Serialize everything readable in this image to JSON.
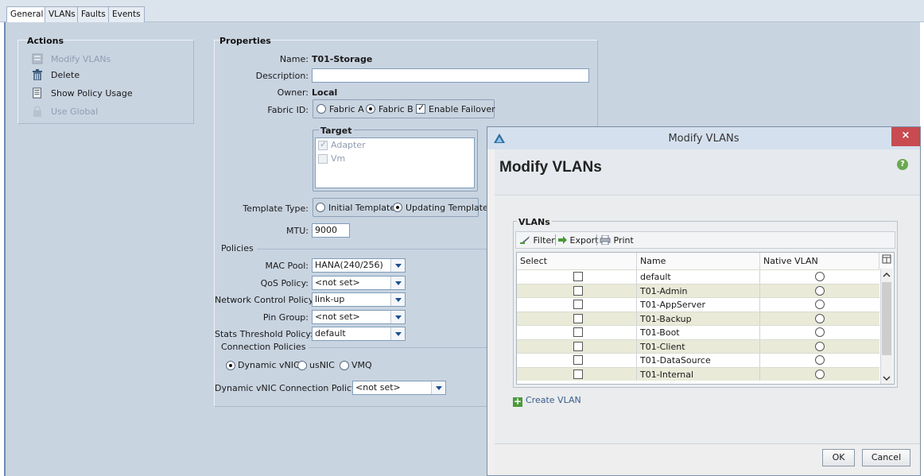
{
  "tabs": [
    {
      "label": "General",
      "active": true
    },
    {
      "label": "VLANs",
      "active": false
    },
    {
      "label": "Faults",
      "active": false
    },
    {
      "label": "Events",
      "active": false
    }
  ],
  "actions": {
    "title": "Actions",
    "items": [
      {
        "label": "Modify VLANs",
        "enabled": false,
        "icon": "vlan-list-icon"
      },
      {
        "label": "Delete",
        "enabled": true,
        "icon": "trash-icon"
      },
      {
        "label": "Show Policy Usage",
        "enabled": true,
        "icon": "document-icon"
      },
      {
        "label": "Use Global",
        "enabled": false,
        "icon": "lock-icon"
      }
    ]
  },
  "properties": {
    "title": "Properties",
    "name_label": "Name:",
    "name_value": "T01-Storage",
    "description_label": "Description:",
    "description_value": "",
    "owner_label": "Owner:",
    "owner_value": "Local",
    "fabric_label": "Fabric ID:",
    "fabric_a": "Fabric A",
    "fabric_b": "Fabric B",
    "fabric_selected": "Fabric B",
    "enable_failover": "Enable Failover",
    "enable_failover_checked": true,
    "target_title": "Target",
    "target_adapter": "Adapter",
    "target_adapter_checked": true,
    "target_vm": "Vm",
    "target_vm_checked": false,
    "template_type_label": "Template Type:",
    "initial_template": "Initial Template",
    "updating_template": "Updating Template",
    "template_selected": "Updating Template",
    "mtu_label": "MTU:",
    "mtu_value": "9000"
  },
  "policies": {
    "title": "Policies",
    "mac_pool_label": "MAC Pool:",
    "mac_pool_value": "HANA(240/256)",
    "qos_label": "QoS Policy:",
    "qos_value": "<not set>",
    "ncp_label": "Network Control Policy:",
    "ncp_value": "link-up",
    "pin_label": "Pin Group:",
    "pin_value": "<not set>",
    "stats_label": "Stats Threshold Policy:",
    "stats_value": "default"
  },
  "connection": {
    "title": "Connection Policies",
    "dynamic_vnic": "Dynamic vNIC",
    "usnic": "usNIC",
    "vmq": "VMQ",
    "selected": "Dynamic vNIC",
    "dvcp_label": "Dynamic vNIC Connection Policy:",
    "dvcp_value": "<not set>"
  },
  "dialog": {
    "window_title": "Modify VLANs",
    "close_glyph": "×",
    "heading": "Modify VLANs",
    "help_glyph": "?",
    "vlans_title": "VLANs",
    "toolbar": {
      "filter": "Filter",
      "export": "Export",
      "print": "Print"
    },
    "columns": [
      "Select",
      "Name",
      "Native VLAN"
    ],
    "rows": [
      {
        "name": "default",
        "selected": false,
        "native": false
      },
      {
        "name": "T01-Admin",
        "selected": false,
        "native": false
      },
      {
        "name": "T01-AppServer",
        "selected": false,
        "native": false
      },
      {
        "name": "T01-Backup",
        "selected": false,
        "native": false
      },
      {
        "name": "T01-Boot",
        "selected": false,
        "native": false
      },
      {
        "name": "T01-Client",
        "selected": false,
        "native": false
      },
      {
        "name": "T01-DataSource",
        "selected": false,
        "native": false
      },
      {
        "name": "T01-Internal",
        "selected": false,
        "native": false
      }
    ],
    "create_vlan": "Create VLAN",
    "ok": "OK",
    "cancel": "Cancel"
  },
  "colors": {
    "panel_bg": "#c9d4e1",
    "dialog_close": "#c74b50",
    "row_alt": "#eaead9",
    "link": "#3a5c8c"
  }
}
